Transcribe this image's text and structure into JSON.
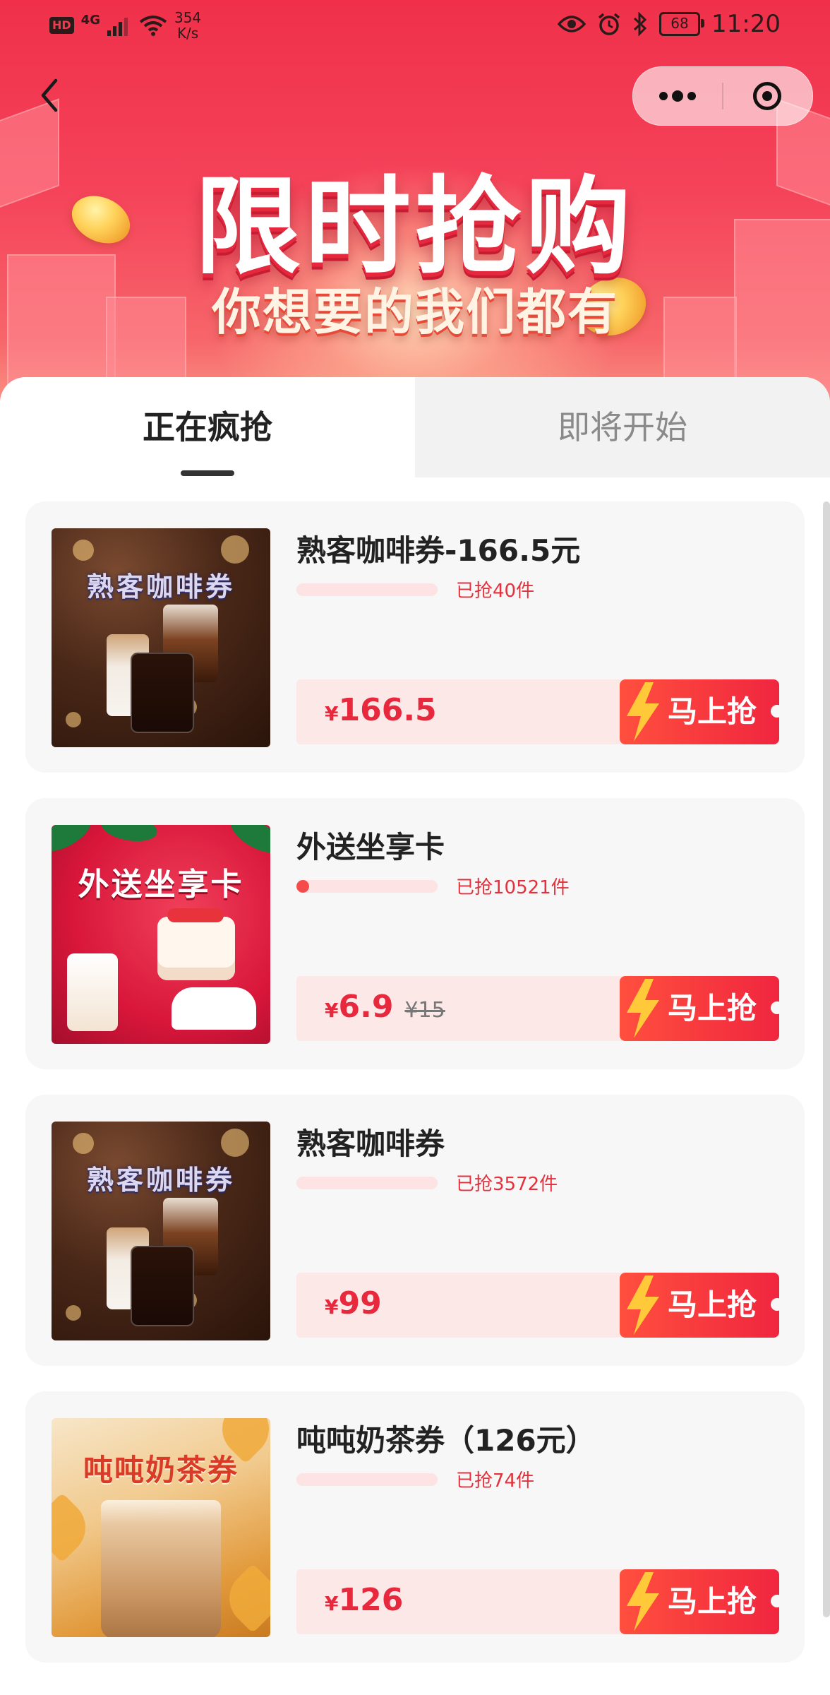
{
  "status_bar": {
    "hd": "HD",
    "net": "4G",
    "speed_value": "354",
    "speed_unit": "K/s",
    "battery": "68",
    "time": "11:20"
  },
  "banner": {
    "title": "限时抢购",
    "subtitle": "你想要的我们都有"
  },
  "tabs": [
    {
      "label": "正在疯抢",
      "active": true
    },
    {
      "label": "即将开始",
      "active": false
    }
  ],
  "products": [
    {
      "title": "熟客咖啡券-166.5元",
      "thumb_text": "熟客咖啡券",
      "thumb_style": "coffee",
      "sold": "已抢40件",
      "progress": 0.0,
      "currency": "¥",
      "price": "166.5",
      "original": "",
      "buy_label": "马上抢"
    },
    {
      "title": "外送坐享卡",
      "thumb_text": "外送坐享卡",
      "thumb_style": "delivery",
      "sold": "已抢10521件",
      "progress": 0.09,
      "currency": "¥",
      "price": "6.9",
      "original": "¥15",
      "buy_label": "马上抢"
    },
    {
      "title": "熟客咖啡券",
      "thumb_text": "熟客咖啡券",
      "thumb_style": "coffee",
      "sold": "已抢3572件",
      "progress": 0.0,
      "currency": "¥",
      "price": "99",
      "original": "",
      "buy_label": "马上抢"
    },
    {
      "title": "吨吨奶茶券（126元）",
      "thumb_text": "吨吨奶茶券",
      "thumb_style": "tea",
      "sold": "已抢74件",
      "progress": 0.0,
      "currency": "¥",
      "price": "126",
      "original": "",
      "buy_label": "马上抢"
    }
  ],
  "colors": {
    "accent": "#f0263f",
    "price": "#e8283d",
    "progress_track": "#fde3e3"
  },
  "icons": {
    "back": "chevron-left-icon",
    "more": "more-dots-icon",
    "close": "target-close-icon",
    "bolt": "lightning-icon"
  }
}
